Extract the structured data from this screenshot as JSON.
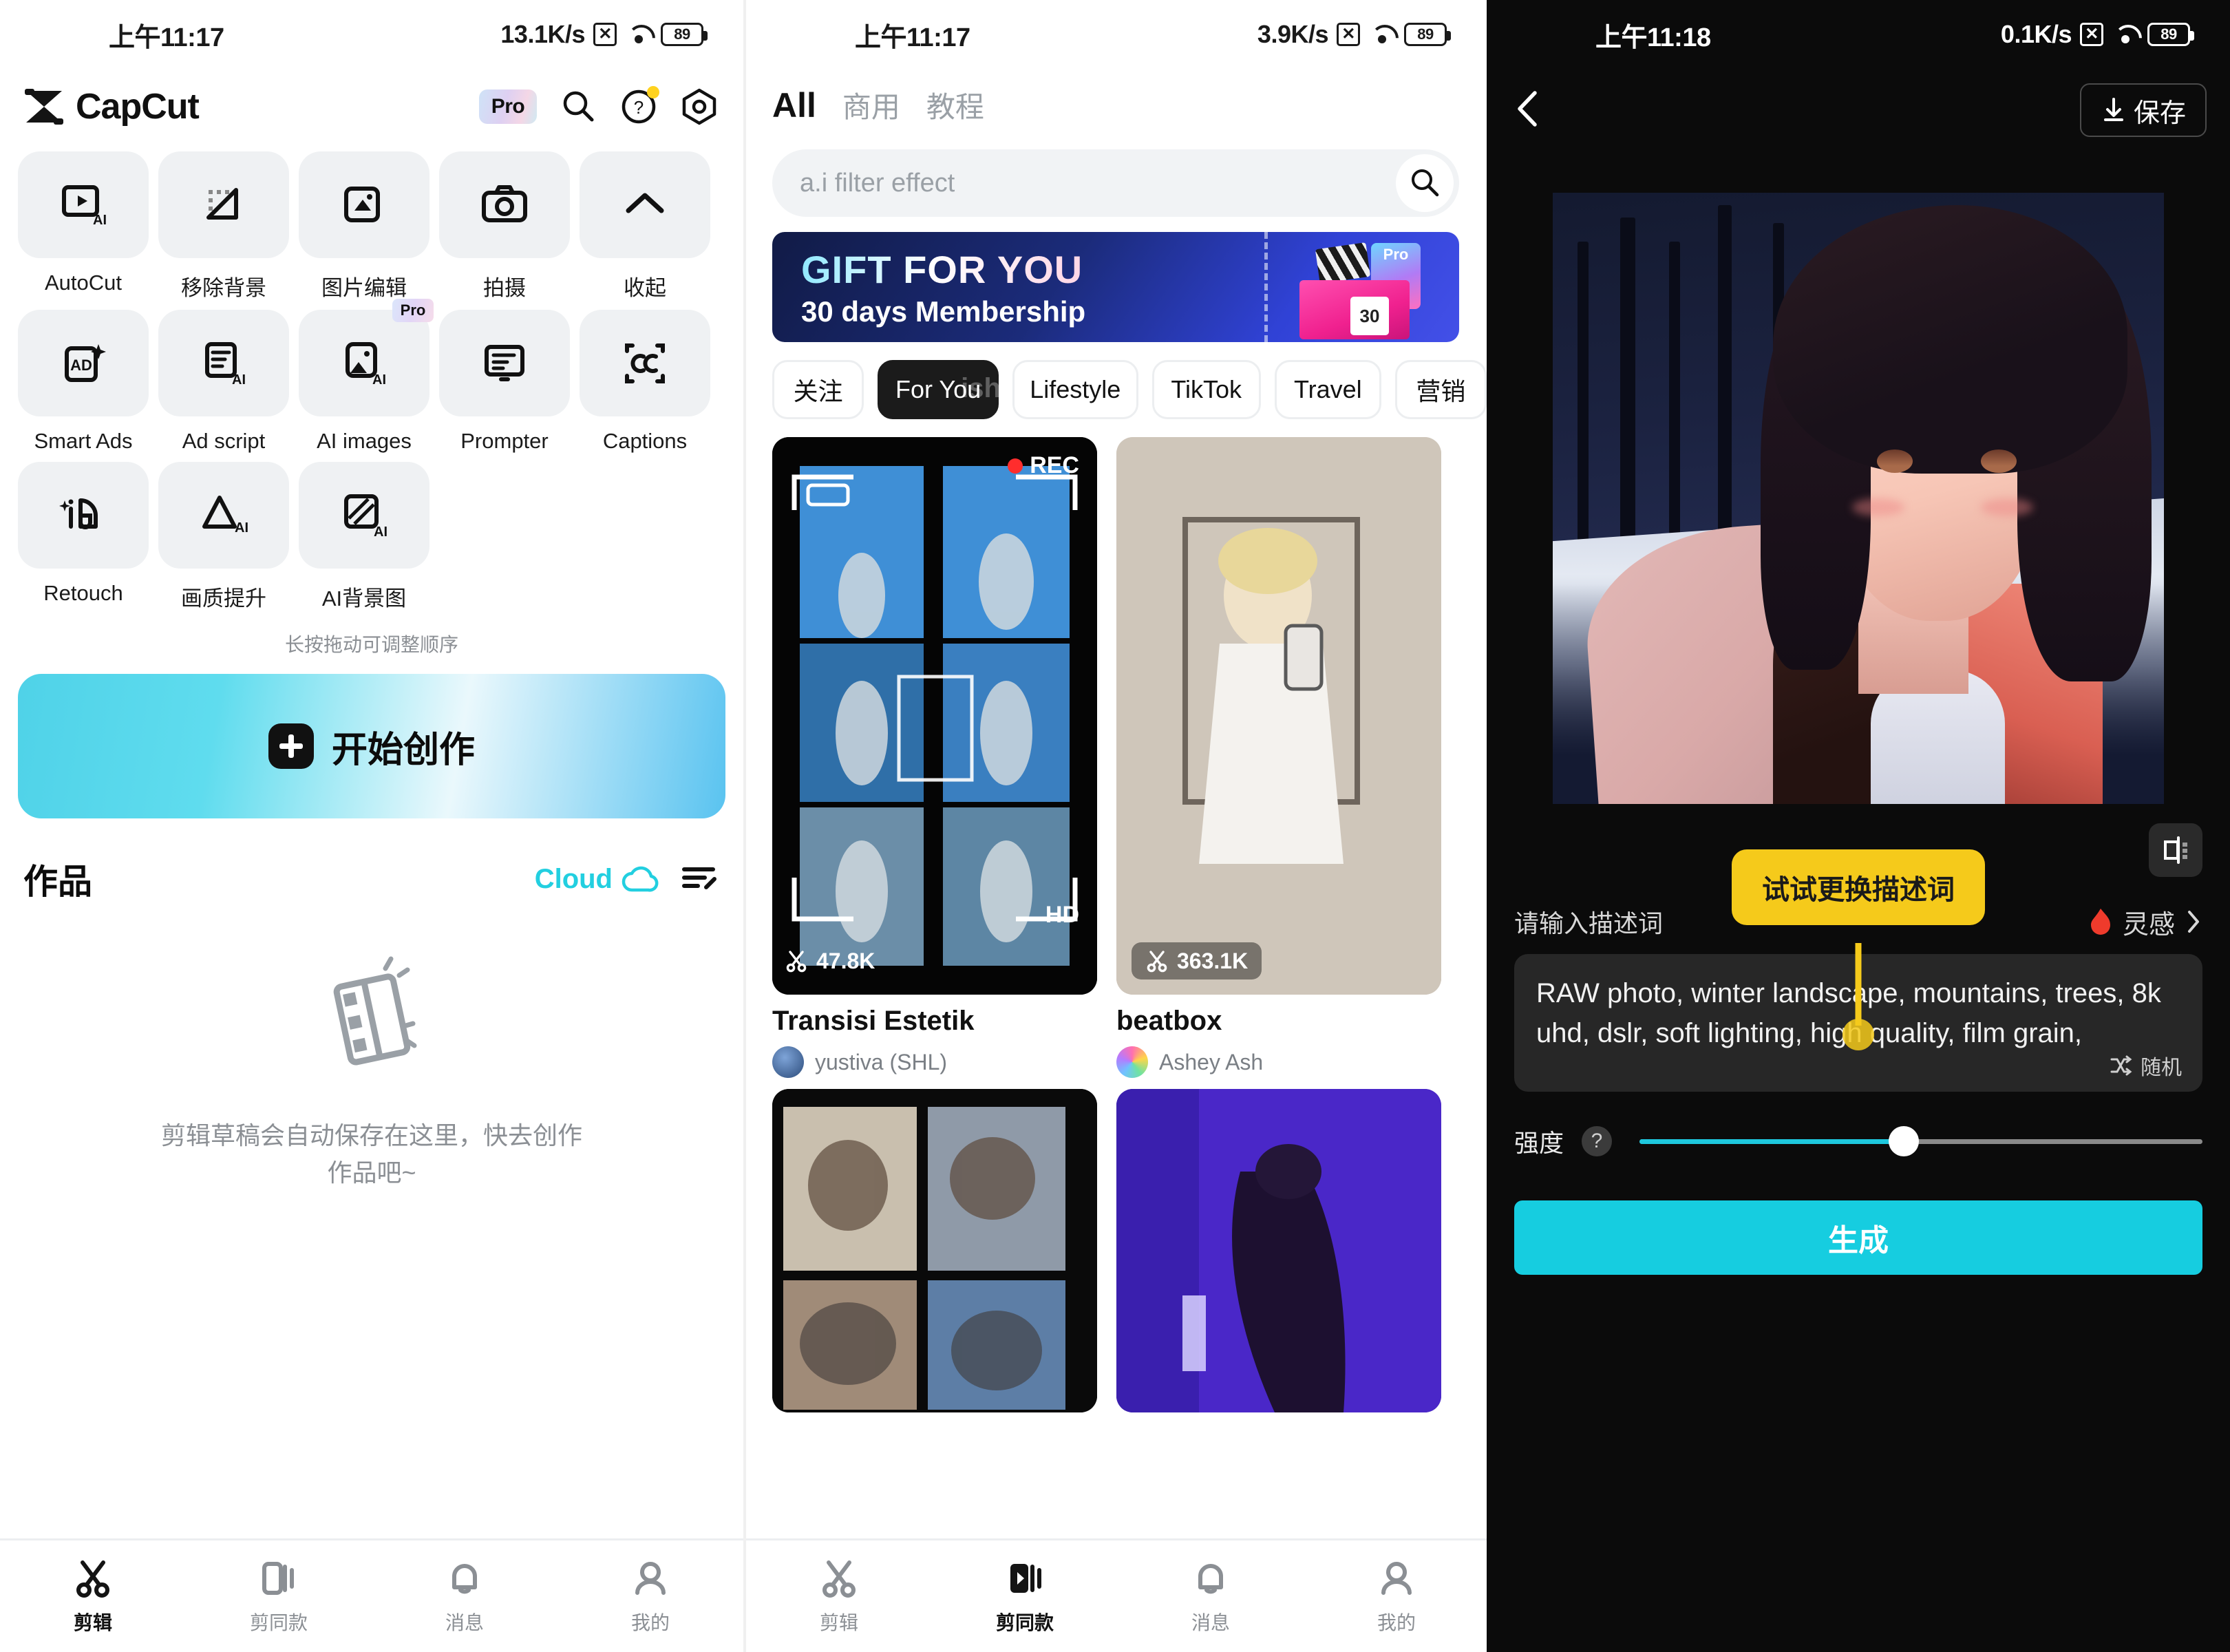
{
  "panel1": {
    "status": {
      "time": "上午11:17",
      "speed": "13.1K/s",
      "battery": "89"
    },
    "header": {
      "brand": "CapCut",
      "pro_label": "Pro",
      "search_icon": "search-icon",
      "help_icon": "help-icon",
      "settings_icon": "gear-icon"
    },
    "tools": [
      {
        "label": "AutoCut",
        "icon": "autocut-ai-icon",
        "pro": ""
      },
      {
        "label": "移除背景",
        "icon": "remove-bg-icon",
        "pro": ""
      },
      {
        "label": "图片编辑",
        "icon": "image-edit-icon",
        "pro": ""
      },
      {
        "label": "拍摄",
        "icon": "camera-icon",
        "pro": ""
      },
      {
        "label": "收起",
        "icon": "chevron-up-icon",
        "pro": ""
      },
      {
        "label": "Smart Ads",
        "icon": "smart-ads-icon",
        "pro": ""
      },
      {
        "label": "Ad script",
        "icon": "ad-script-ai-icon",
        "pro": ""
      },
      {
        "label": "AI images",
        "icon": "ai-images-icon",
        "pro": "Pro"
      },
      {
        "label": "Prompter",
        "icon": "prompter-icon",
        "pro": ""
      },
      {
        "label": "Captions",
        "icon": "captions-icon",
        "pro": ""
      },
      {
        "label": "Retouch",
        "icon": "retouch-icon",
        "pro": ""
      },
      {
        "label": "画质提升",
        "icon": "upscale-ai-icon",
        "pro": ""
      },
      {
        "label": "AI背景图",
        "icon": "ai-background-icon",
        "pro": ""
      }
    ],
    "drag_hint": "长按拖动可调整顺序",
    "create_button": "开始创作",
    "works": {
      "title": "作品",
      "cloud_label": "Cloud",
      "empty_text": "剪辑草稿会自动保存在这里，快去创作作品吧~"
    },
    "nav": [
      {
        "label": "剪辑",
        "icon": "scissors-icon",
        "active": true
      },
      {
        "label": "剪同款",
        "icon": "templates-icon",
        "active": false
      },
      {
        "label": "消息",
        "icon": "bell-icon",
        "active": false
      },
      {
        "label": "我的",
        "icon": "person-icon",
        "active": false
      }
    ]
  },
  "panel2": {
    "status": {
      "time": "上午11:17",
      "speed": "3.9K/s",
      "battery": "89"
    },
    "tabs": [
      {
        "label": "All",
        "active": true
      },
      {
        "label": "商用",
        "active": false
      },
      {
        "label": "教程",
        "active": false
      }
    ],
    "search": {
      "placeholder": "a.i filter effect",
      "icon": "search-icon"
    },
    "banner": {
      "title": "GIFT FOR YOU",
      "subtitle": "30 days Membership",
      "pro_tag": "Pro",
      "days": "30"
    },
    "chips": [
      {
        "label": "关注",
        "active": false,
        "watermark": ""
      },
      {
        "label": "For You",
        "active": true,
        "watermark": "ish"
      },
      {
        "label": "Lifestyle",
        "active": false,
        "watermark": ""
      },
      {
        "label": "TikTok",
        "active": false,
        "watermark": ""
      },
      {
        "label": "Travel",
        "active": false,
        "watermark": ""
      },
      {
        "label": "营销",
        "active": false,
        "watermark": ""
      }
    ],
    "cards": [
      {
        "title": "Transisi Estetik",
        "user": "yustiva (SHL)",
        "uses": "47.8K",
        "hd": "HD",
        "rec": "REC"
      },
      {
        "title": "beatbox",
        "user": "Ashey Ash",
        "uses": "363.1K",
        "hd": "",
        "rec": ""
      }
    ],
    "nav": [
      {
        "label": "剪辑",
        "icon": "scissors-icon",
        "active": false
      },
      {
        "label": "剪同款",
        "icon": "templates-icon",
        "active": true
      },
      {
        "label": "消息",
        "icon": "bell-icon",
        "active": false
      },
      {
        "label": "我的",
        "icon": "person-icon",
        "active": false
      }
    ]
  },
  "panel3": {
    "status": {
      "time": "上午11:18",
      "speed": "0.1K/s",
      "battery": "89"
    },
    "back_icon": "chevron-left-icon",
    "save_label": "保存",
    "compare_icon": "compare-icon",
    "prompt_label": "请输入描述词",
    "inspiration_label": "灵感",
    "inspiration_icon": "flame-icon",
    "tooltip": "试试更换描述词",
    "prompt_text": "RAW photo, winter landscape, mountains, trees, 8k uhd, dslr, soft lighting, high quality, film grain,",
    "random_label": "随机",
    "random_icon": "shuffle-icon",
    "strength_label": "强度",
    "strength_help": "?",
    "strength_value": 47,
    "generate_label": "生成",
    "accent_color": "#16cde0",
    "tooltip_color": "#f5ca1b"
  }
}
